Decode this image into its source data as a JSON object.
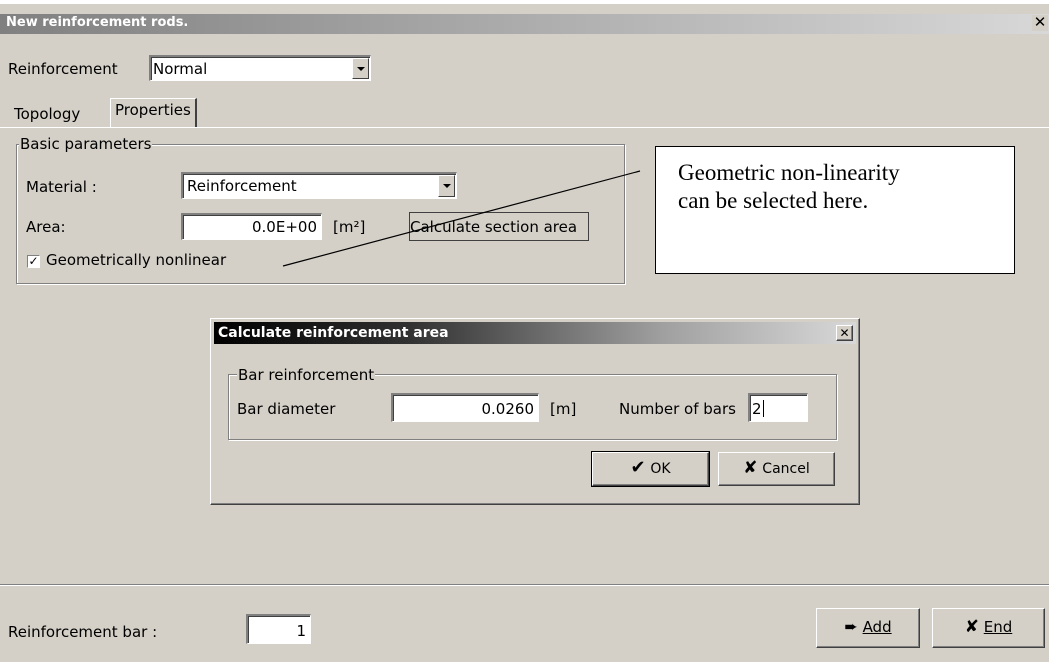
{
  "window": {
    "title": "New reinforcement rods.",
    "close_glyph": "✕"
  },
  "reinforcement": {
    "label": "Reinforcement",
    "value": "Normal"
  },
  "tabs": [
    {
      "label": "Topology"
    },
    {
      "label": "Properties"
    }
  ],
  "basic": {
    "group_label": "Basic parameters",
    "material_label": "Material :",
    "material_value": "Reinforcement",
    "area_label": "Area:",
    "area_value": "0.0E+00",
    "area_unit": "[m²]",
    "calc_button": "Calculate section area",
    "geom_checkbox_label": "Geometrically nonlinear",
    "geom_checked": true
  },
  "callout": {
    "line1": "Geometric  non-linearity",
    "line2": "can be selected here."
  },
  "dialog": {
    "title": "Calculate reinforcement area",
    "close_glyph": "✕",
    "group_label": "Bar reinforcement",
    "diameter_label": "Bar diameter",
    "diameter_value": "0.0260",
    "diameter_unit": "[m]",
    "nbars_label": "Number of bars",
    "nbars_value": "2",
    "ok_label": "OK",
    "cancel_label": "Cancel"
  },
  "footer": {
    "bar_label": "Reinforcement bar :",
    "bar_value": "1",
    "add_label": "Add",
    "end_label": "End"
  },
  "icons": {
    "ok": "check-icon",
    "cancel": "x-icon",
    "add": "arrow-right-icon",
    "end": "x-icon"
  }
}
